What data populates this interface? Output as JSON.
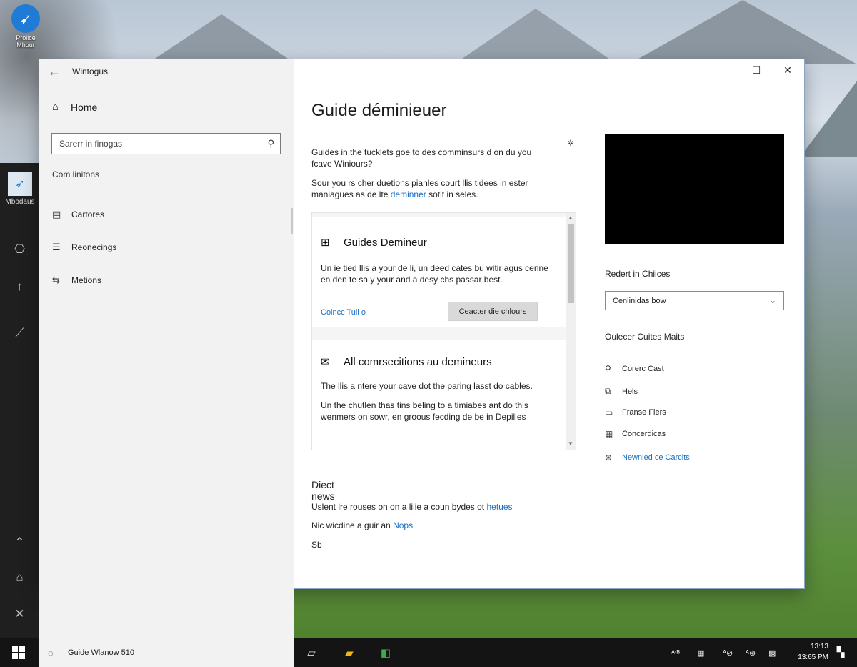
{
  "desktop": {
    "icon_label": "Prolice Mhour"
  },
  "rail": {
    "app_label": "Mbodaus",
    "buttons": [
      "settings-icon",
      "up-arrow-icon",
      "pen-icon",
      "chevron-up-icon",
      "people-icon",
      "close-icon"
    ]
  },
  "window": {
    "title": "Wintogus",
    "nav": {
      "home_label": "Home",
      "search_placeholder": "Sarerr in finogas",
      "section_label": "Com linitons",
      "items": [
        {
          "label": "Cartores",
          "icon": "document-icon"
        },
        {
          "label": "Reonecings",
          "icon": "list-icon"
        },
        {
          "label": "Metions",
          "icon": "sliders-icon"
        }
      ]
    },
    "controls": {
      "minimize": "—",
      "maximize": "☐",
      "close": "✕"
    },
    "main": {
      "title": "Guide déminieuer",
      "intro_1": "Guides in the tucklets goe to des comminsurs d on du you fcave Winiours?",
      "intro_2_before_link": "Sour you rs cher duetions pianles court llis tidees in ester maniagues as de lte ",
      "intro_2_link": "deminner",
      "intro_2_after_link": " sotit in seles.",
      "card1": {
        "title": "Guides Demineur",
        "body": "Un ie tied llis a your de li, un deed cates bu witir agus cenne en den te sa y your and a desy chs passar best.",
        "link": "Coincc Tull o",
        "button": "Ceacter die chlours"
      },
      "card2": {
        "title": "All comrsecitions au demineurs",
        "body_1": "The llis a ntere your cave dot the paring lasst do cables.",
        "body_2": "Un the chutlen thas tins beling to a timiabes ant do this wenmers on sowr, en groous fecding de be in Depilies"
      },
      "news": {
        "heading": "Diect news",
        "line1_before": "Uslent lre rouses on on a lilie a coun bydes ot ",
        "line1_link": "hetues",
        "line2_before": "Nic wicdine a guir an ",
        "line2_link": "Nops",
        "line3": "Sb"
      }
    },
    "right": {
      "recent_label": "Redert in Chiices",
      "dropdown_value": "Cenlinidas bow",
      "guides_label": "Oulecer Cuites Maits",
      "items": [
        {
          "label": "Corerc Cast",
          "icon": "pin-icon",
          "blue": false
        },
        {
          "label": "Hels",
          "icon": "copy-icon",
          "blue": false
        },
        {
          "label": "Franse Fiers",
          "icon": "chat-icon",
          "blue": false
        },
        {
          "label": "Concerdicas",
          "icon": "grid-icon",
          "blue": false
        },
        {
          "label": "Newnied ce Carcits",
          "icon": "share-icon",
          "blue": true
        }
      ]
    }
  },
  "taskbar": {
    "search_text": "Guide Wlanow 510",
    "apps": [
      "task-view-icon",
      "file-explorer-icon",
      "store-icon"
    ],
    "tray": [
      "ᴬ⁽ᴮ",
      "▦",
      "ᴬ⊘",
      "ᴬ⊛",
      "▩"
    ],
    "clock_time": "13:13",
    "clock_date": "13:65 PM"
  }
}
